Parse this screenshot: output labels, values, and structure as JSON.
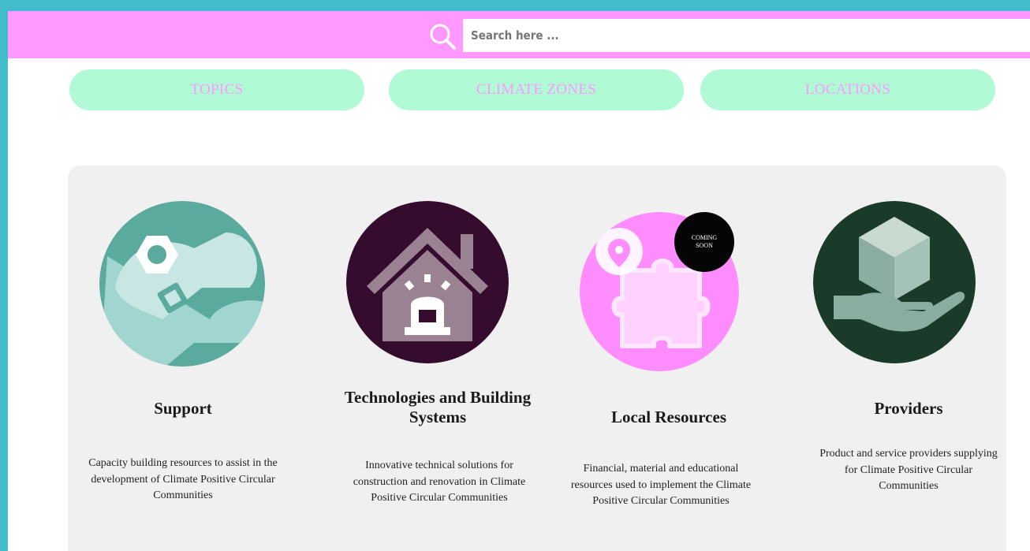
{
  "search": {
    "placeholder": "Search here ..."
  },
  "filters": [
    {
      "label": "TOPICS"
    },
    {
      "label": "CLIMATE ZONES"
    },
    {
      "label": "LOCATIONS"
    }
  ],
  "badge": {
    "line1": "COMING",
    "line2": "SOON"
  },
  "cards": [
    {
      "title": "Support",
      "description": "Capacity building resources to assist in the development of Climate Positive Circular Communities",
      "icon": "wrench-nut-chip-icon",
      "color": "#5aaa9d"
    },
    {
      "title": "Technologies and Building Systems",
      "description": "Innovative technical solutions for construction and renovation in Climate Positive Circular Communities",
      "icon": "house-icon",
      "color": "#350b2e"
    },
    {
      "title": "Local Resources",
      "description": "Financial, material and educational resources used to implement the Climate Positive Circular Communities",
      "icon": "puzzle-location-icon",
      "color": "#ff8dff"
    },
    {
      "title": "Providers",
      "description": "Product and service providers supplying for Climate Positive Circular Communities",
      "icon": "hand-box-icon",
      "color": "#1a3a2a"
    }
  ],
  "colors": {
    "frame": "#42bccb",
    "searchbar": "#ff99ff",
    "filter_bg": "#b1fad6",
    "filter_text": "#ff99ff",
    "panel": "#f0f0f0"
  }
}
